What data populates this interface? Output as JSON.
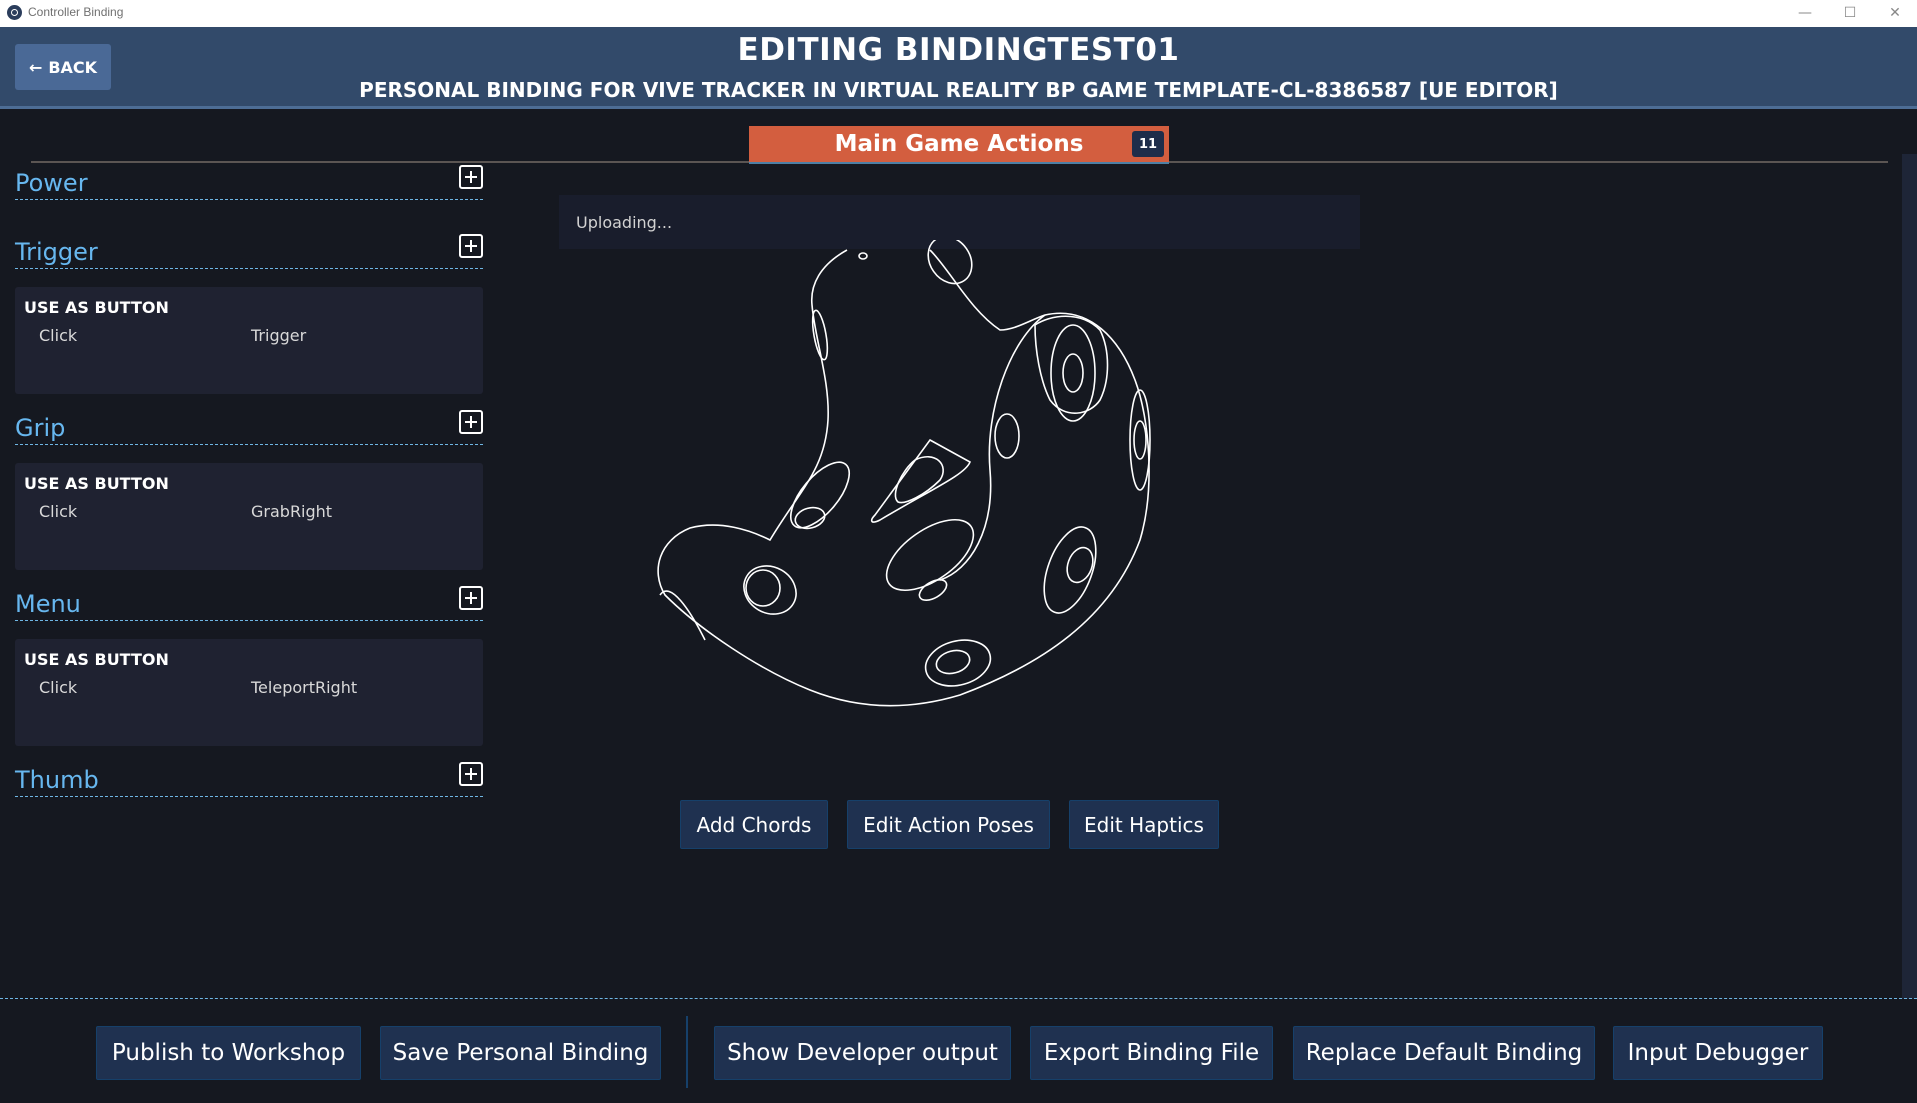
{
  "window": {
    "title": "Controller Binding",
    "controls": {
      "minimize": "—",
      "maximize": "☐",
      "close": "✕"
    }
  },
  "header": {
    "back_label": "BACK",
    "back_icon": "arrow-left-icon",
    "title": "EDITING BINDINGTEST01",
    "subtitle": "PERSONAL BINDING FOR VIVE TRACKER IN VIRTUAL REALITY BP GAME TEMPLATE-CL-8386587 [UE EDITOR]"
  },
  "action_set_tab": {
    "label": "Main Game Actions",
    "count": "11",
    "color": "#d35e3f"
  },
  "status": {
    "text": "Uploading..."
  },
  "inputs": [
    {
      "name": "Power",
      "bindings": []
    },
    {
      "name": "Trigger",
      "bindings": [
        {
          "mode": "USE AS BUTTON",
          "input": "Click",
          "action": "Trigger"
        }
      ]
    },
    {
      "name": "Grip",
      "bindings": [
        {
          "mode": "USE AS BUTTON",
          "input": "Click",
          "action": "GrabRight"
        }
      ]
    },
    {
      "name": "Menu",
      "bindings": [
        {
          "mode": "USE AS BUTTON",
          "input": "Click",
          "action": "TeleportRight"
        }
      ]
    },
    {
      "name": "Thumb",
      "bindings": []
    }
  ],
  "device_image": {
    "icon": "vive-tracker-icon"
  },
  "center_buttons": {
    "add_chords": "Add Chords",
    "edit_action_poses": "Edit Action Poses",
    "edit_haptics": "Edit Haptics"
  },
  "footer_buttons": {
    "publish": "Publish to Workshop",
    "save": "Save Personal Binding",
    "dev_output": "Show Developer output",
    "export": "Export Binding File",
    "replace_default": "Replace Default Binding",
    "debugger": "Input Debugger"
  }
}
